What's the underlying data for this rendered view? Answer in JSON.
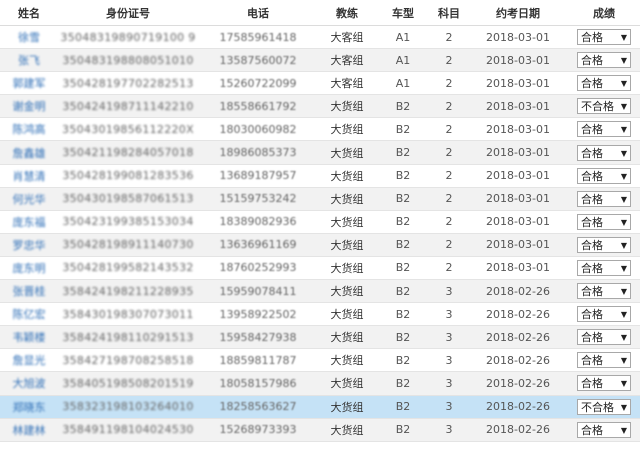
{
  "headers": {
    "name": "姓名",
    "id_number": "身份证号",
    "phone": "电话",
    "coach": "教练",
    "car_type": "车型",
    "subject": "科目",
    "exam_date": "约考日期",
    "result": "成绩"
  },
  "result_caret": "▼",
  "rows": [
    {
      "name": "徐雪",
      "id": "35048319890719100 9",
      "phone": "17585961418",
      "coach": "大客组",
      "car": "A1",
      "subject": "2",
      "date": "2018-03-01",
      "result": "合格"
    },
    {
      "name": "张飞",
      "id": "350483198808051010",
      "phone": "13587560072",
      "coach": "大客组",
      "car": "A1",
      "subject": "2",
      "date": "2018-03-01",
      "result": "合格"
    },
    {
      "name": "郭建军",
      "id": "350428197702282513",
      "phone": "15260722099",
      "coach": "大客组",
      "car": "A1",
      "subject": "2",
      "date": "2018-03-01",
      "result": "合格"
    },
    {
      "name": "谢金明",
      "id": "350424198711142210",
      "phone": "18558661792",
      "coach": "大货组",
      "car": "B2",
      "subject": "2",
      "date": "2018-03-01",
      "result": "不合格"
    },
    {
      "name": "陈鸿高",
      "id": "35043019856112220X",
      "phone": "18030060982",
      "coach": "大货组",
      "car": "B2",
      "subject": "2",
      "date": "2018-03-01",
      "result": "合格"
    },
    {
      "name": "詹鑫雄",
      "id": "350421198284057018",
      "phone": "18986085373",
      "coach": "大货组",
      "car": "B2",
      "subject": "2",
      "date": "2018-03-01",
      "result": "合格"
    },
    {
      "name": "肖慧清",
      "id": "350428199081283536",
      "phone": "13689187957",
      "coach": "大货组",
      "car": "B2",
      "subject": "2",
      "date": "2018-03-01",
      "result": "合格"
    },
    {
      "name": "何光华",
      "id": "350430198587061513",
      "phone": "15159753242",
      "coach": "大货组",
      "car": "B2",
      "subject": "2",
      "date": "2018-03-01",
      "result": "合格"
    },
    {
      "name": "庞东福",
      "id": "350423199385153034",
      "phone": "18389082936",
      "coach": "大货组",
      "car": "B2",
      "subject": "2",
      "date": "2018-03-01",
      "result": "合格"
    },
    {
      "name": "罗忠华",
      "id": "350428198911140730",
      "phone": "13636961169",
      "coach": "大货组",
      "car": "B2",
      "subject": "2",
      "date": "2018-03-01",
      "result": "合格"
    },
    {
      "name": "庞东明",
      "id": "350428199582143532",
      "phone": "18760252993",
      "coach": "大货组",
      "car": "B2",
      "subject": "2",
      "date": "2018-03-01",
      "result": "合格"
    },
    {
      "name": "张晋桂",
      "id": "358424198211228935",
      "phone": "15959078411",
      "coach": "大货组",
      "car": "B2",
      "subject": "3",
      "date": "2018-02-26",
      "result": "合格"
    },
    {
      "name": "陈亿宏",
      "id": "358430198307073011",
      "phone": "13958922502",
      "coach": "大货组",
      "car": "B2",
      "subject": "3",
      "date": "2018-02-26",
      "result": "合格"
    },
    {
      "name": "韦颖楼",
      "id": "358424198110291513",
      "phone": "15958427938",
      "coach": "大货组",
      "car": "B2",
      "subject": "3",
      "date": "2018-02-26",
      "result": "合格"
    },
    {
      "name": "詹显光",
      "id": "358427198708258518",
      "phone": "18859811787",
      "coach": "大货组",
      "car": "B2",
      "subject": "3",
      "date": "2018-02-26",
      "result": "合格"
    },
    {
      "name": "大旭波",
      "id": "358405198508201519",
      "phone": "18058157986",
      "coach": "大货组",
      "car": "B2",
      "subject": "3",
      "date": "2018-02-26",
      "result": "合格"
    },
    {
      "name": "郑晓东",
      "id": "358323198103264010",
      "phone": "18258563627",
      "coach": "大货组",
      "car": "B2",
      "subject": "3",
      "date": "2018-02-26",
      "result": "不合格"
    },
    {
      "name": "林建林",
      "id": "358491198104024530",
      "phone": "15268973393",
      "coach": "大货组",
      "car": "B2",
      "subject": "3",
      "date": "2018-02-26",
      "result": "合格"
    }
  ],
  "selected_row": 16
}
